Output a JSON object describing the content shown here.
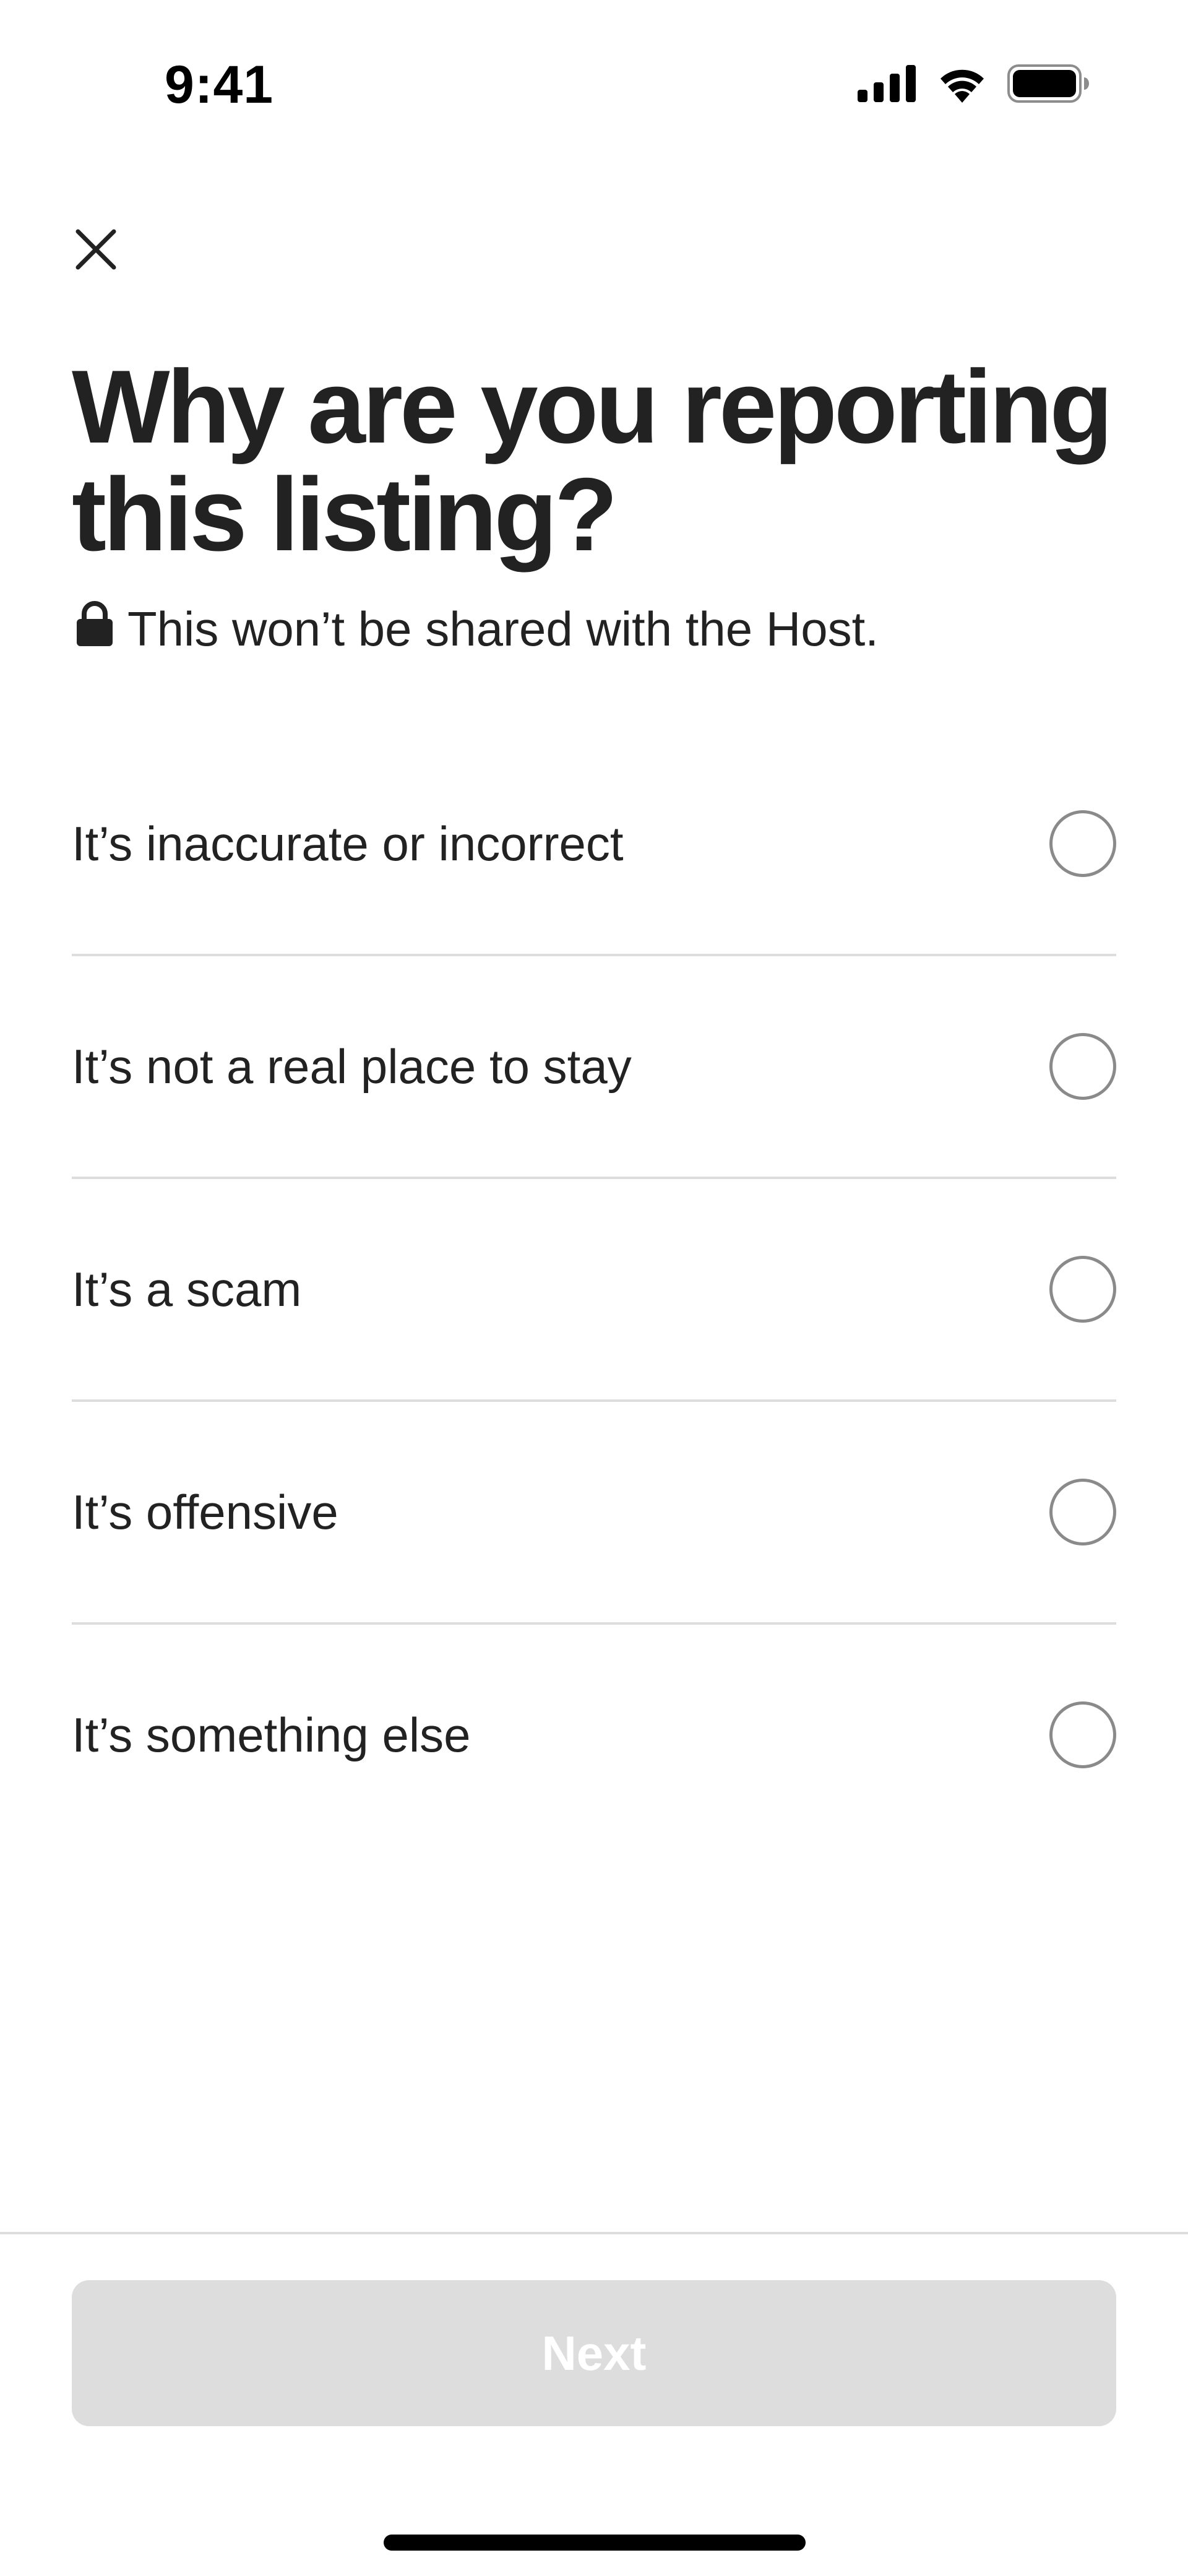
{
  "status_bar": {
    "time": "9:41",
    "icons": [
      "cellular-signal-icon",
      "wifi-icon",
      "battery-icon"
    ]
  },
  "header": {
    "close_icon": "close-icon"
  },
  "title": "Why are you reporting this listing?",
  "privacy_note": {
    "icon": "lock-icon",
    "text": "This won’t be shared with the Host."
  },
  "options": [
    {
      "label": "It’s inaccurate or incorrect",
      "selected": false
    },
    {
      "label": "It’s not a real place to stay",
      "selected": false
    },
    {
      "label": "It’s a scam",
      "selected": false
    },
    {
      "label": "It’s offensive",
      "selected": false
    },
    {
      "label": "It’s something else",
      "selected": false
    }
  ],
  "footer": {
    "next_label": "Next",
    "next_enabled": false
  },
  "colors": {
    "text": "#222222",
    "divider": "#dddddd",
    "radio_border": "#8a8a8a",
    "disabled_button": "#dddddd",
    "disabled_button_text": "#ffffff"
  }
}
